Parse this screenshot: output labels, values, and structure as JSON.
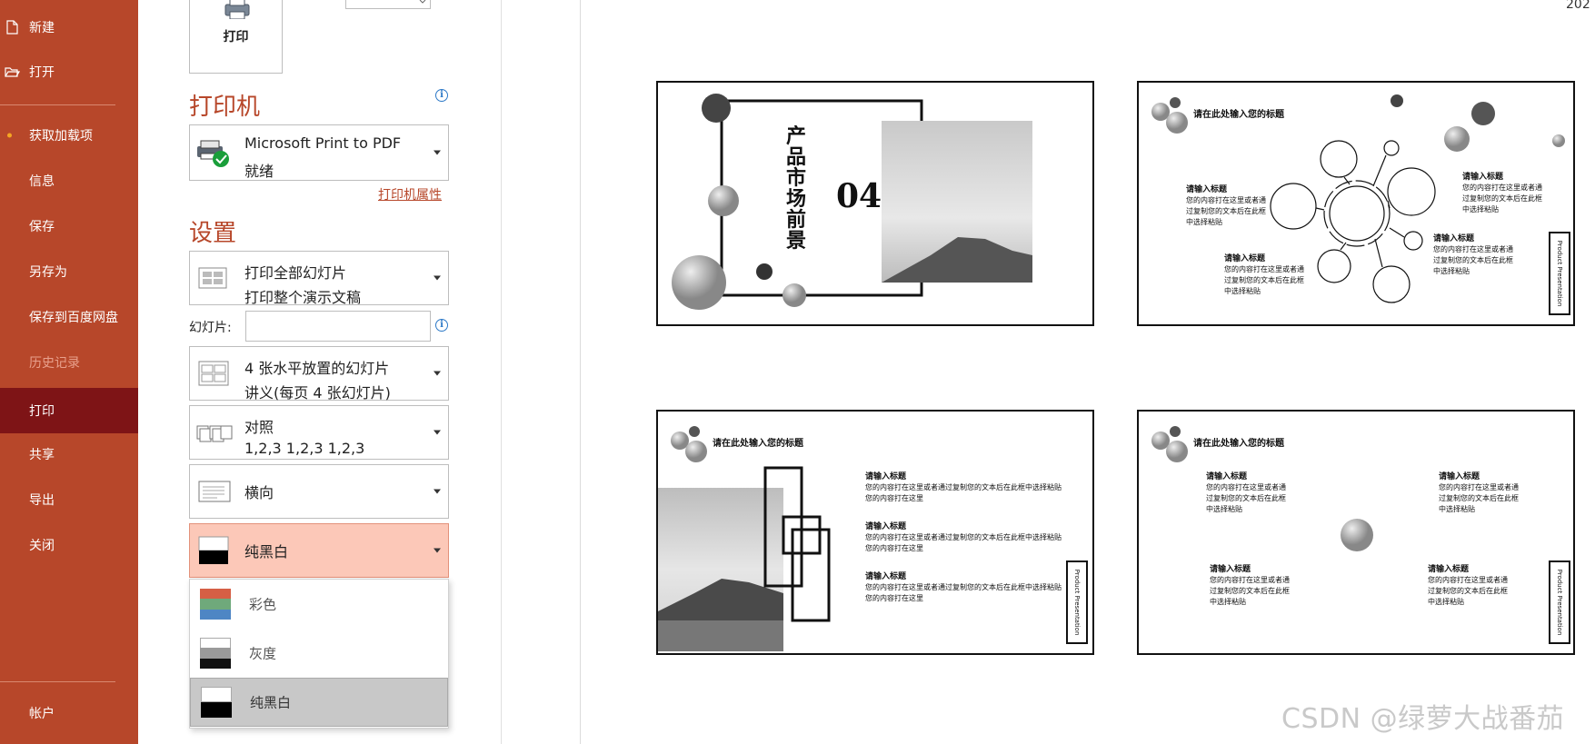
{
  "sidebar": {
    "items": [
      {
        "label": "新建"
      },
      {
        "label": "打开"
      },
      {
        "label": "获取加载项"
      },
      {
        "label": "信息"
      },
      {
        "label": "保存"
      },
      {
        "label": "另存为"
      },
      {
        "label": "保存到百度网盘"
      },
      {
        "label": "历史记录"
      },
      {
        "label": "打印"
      },
      {
        "label": "共享"
      },
      {
        "label": "导出"
      },
      {
        "label": "关闭"
      },
      {
        "label": "帐户"
      }
    ]
  },
  "print_button": {
    "label": "打印"
  },
  "printer": {
    "section_title": "打印机",
    "name": "Microsoft Print to PDF",
    "status": "就绪",
    "properties_link": "打印机属性"
  },
  "settings": {
    "section_title": "设置",
    "range": {
      "line1": "打印全部幻灯片",
      "line2": "打印整个演示文稿"
    },
    "slides_label": "幻灯片:",
    "slides_value": "",
    "layout": {
      "line1": "4 张水平放置的幻灯片",
      "line2": "讲义(每页 4 张幻灯片)"
    },
    "collate": {
      "line1": "对照",
      "line2": "1,2,3     1,2,3     1,2,3"
    },
    "orientation": {
      "label": "横向"
    },
    "color": {
      "label": "纯黑白"
    }
  },
  "color_menu": {
    "options": [
      {
        "label": "彩色"
      },
      {
        "label": "灰度"
      },
      {
        "label": "纯黑白"
      }
    ]
  },
  "preview": {
    "page_number_partial": "202",
    "watermark": "CSDN @绿萝大战番茄",
    "slide1": {
      "vertical_title": "产品市场前景",
      "number": "04"
    },
    "common": {
      "slide_title": "请在此处输入您的标题",
      "item_title": "请输入标题",
      "body_line1": "您的内容打在这里或者通",
      "body_line2": "过复制您的文本后在此框",
      "body_line3": "中选择粘贴",
      "long_line1": "您的内容打在这里或者通过复制您的文本后在此框中选择粘贴",
      "long_line2": "您的内容打在这里",
      "badge": "Product Presentation"
    }
  },
  "colors": {
    "accent": "#B7472A",
    "sidebar_active": "#7E1416",
    "selected_dropdown": "#FCC8B8",
    "info_blue": "#2B78C7"
  }
}
